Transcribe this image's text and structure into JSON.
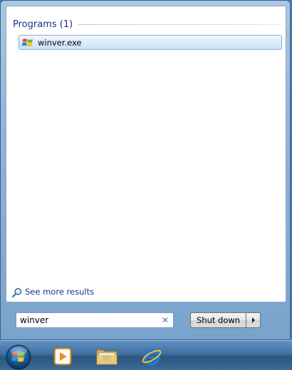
{
  "results": {
    "group_title": "Programs (1)",
    "items": [
      {
        "label": "winver.exe",
        "icon": "windows-logo-icon"
      }
    ]
  },
  "see_more": {
    "label": "See more results",
    "icon": "search-icon"
  },
  "search": {
    "value": "winver",
    "clear_icon": "clear-icon"
  },
  "shutdown": {
    "label": "Shut down",
    "arrow_icon": "triangle-right-icon"
  },
  "taskbar": {
    "start_icon": "windows-start-orb-icon",
    "pinned": [
      {
        "name": "windows-media-player-icon"
      },
      {
        "name": "windows-explorer-icon"
      },
      {
        "name": "internet-explorer-icon"
      }
    ]
  },
  "colors": {
    "accent": "#1e3287",
    "selection_border": "#84acdd",
    "taskbar": "#3f6f9f"
  }
}
